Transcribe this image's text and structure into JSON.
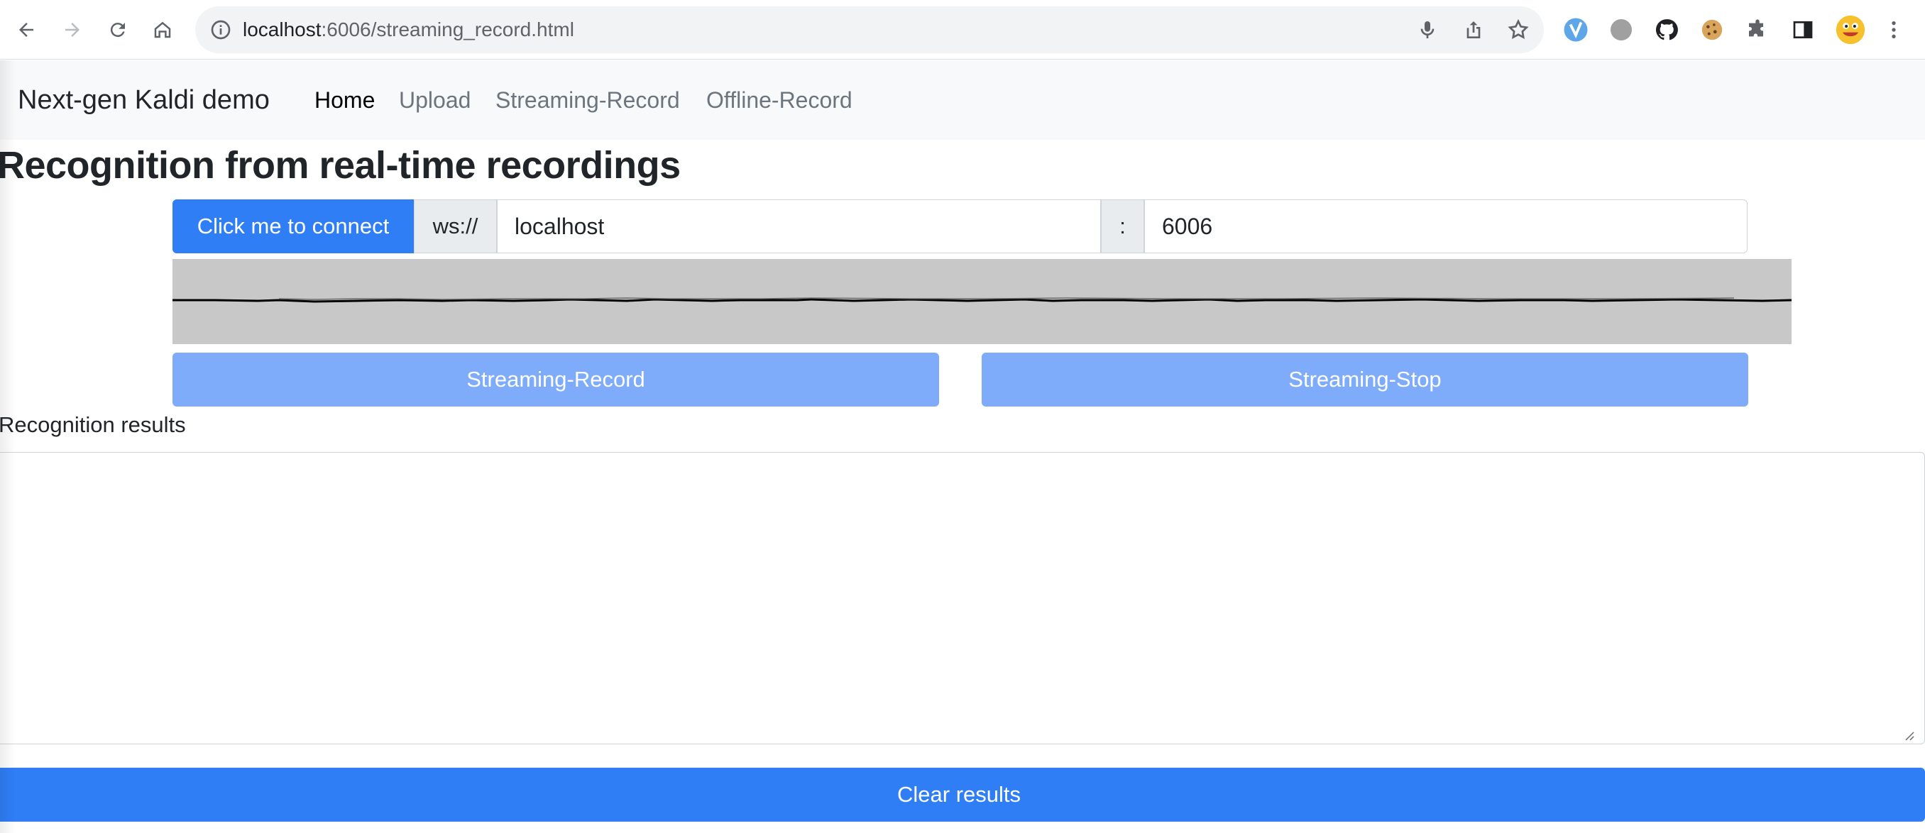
{
  "browser": {
    "url_host": "localhost",
    "url_rest": ":6006/streaming_record.html"
  },
  "navbar": {
    "brand": "Next-gen Kaldi demo",
    "links": [
      {
        "label": "Home",
        "active": true
      },
      {
        "label": "Upload",
        "active": false
      },
      {
        "label": "Streaming-Record",
        "active": false
      },
      {
        "label": "Offline-Record",
        "active": false
      }
    ]
  },
  "page": {
    "title": "Recognition from real-time recordings"
  },
  "connection": {
    "connect_label": "Click me to connect",
    "protocol": "ws://",
    "host": "localhost",
    "separator": ":",
    "port": "6006"
  },
  "controls": {
    "record_label": "Streaming-Record",
    "stop_label": "Streaming-Stop"
  },
  "results": {
    "label": "Recognition results",
    "text": "",
    "clear_label": "Clear results"
  },
  "colors": {
    "primary": "#2f7ef6",
    "primary_disabled": "#7eacfa",
    "navbar_bg": "#f8f9fa",
    "waveform_bg": "#c8c8c8"
  }
}
